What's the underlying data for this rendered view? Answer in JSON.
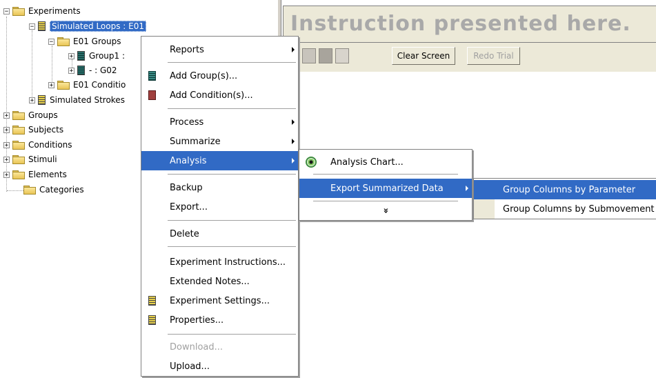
{
  "tree": {
    "items": [
      {
        "label": "Experiments",
        "expander": "−"
      },
      {
        "label": "Simulated Loops : E01",
        "expander": "−"
      },
      {
        "label": "E01 Groups",
        "expander": "−"
      },
      {
        "label": "Group1 :",
        "expander": "+"
      },
      {
        "label": "- : G02",
        "expander": "+"
      },
      {
        "label": "E01 Conditio",
        "expander": "+"
      },
      {
        "label": "Simulated Strokes",
        "expander": "+"
      },
      {
        "label": "Groups",
        "expander": "+"
      },
      {
        "label": "Subjects",
        "expander": "+"
      },
      {
        "label": "Conditions",
        "expander": "+"
      },
      {
        "label": "Stimuli",
        "expander": "+"
      },
      {
        "label": "Elements",
        "expander": "+"
      },
      {
        "label": "Categories",
        "expander": ""
      }
    ]
  },
  "instruction_text": "Instruction presented here.",
  "toolbar": {
    "clear_screen": "Clear Screen",
    "redo_trial": "Redo Trial"
  },
  "context_menu": {
    "reports": "Reports",
    "add_groups": "Add Group(s)...",
    "add_conditions": "Add Condition(s)...",
    "process": "Process",
    "summarize": "Summarize",
    "analysis": "Analysis",
    "backup": "Backup",
    "export": "Export...",
    "delete": "Delete",
    "experiment_instructions": "Experiment Instructions...",
    "extended_notes": "Extended Notes...",
    "experiment_settings": "Experiment Settings...",
    "properties": "Properties...",
    "download": "Download...",
    "upload": "Upload..."
  },
  "analysis_menu": {
    "analysis_chart": "Analysis Chart...",
    "export_summarized": "Export Summarized Data",
    "more": "»"
  },
  "export_menu": {
    "by_parameter": "Group Columns by Parameter",
    "by_submovement": "Group Columns by Submovement"
  },
  "colors": {
    "highlight": "#316ac5",
    "menu_bg": "#ffffff",
    "toolbar_bg": "#ece9d8"
  }
}
